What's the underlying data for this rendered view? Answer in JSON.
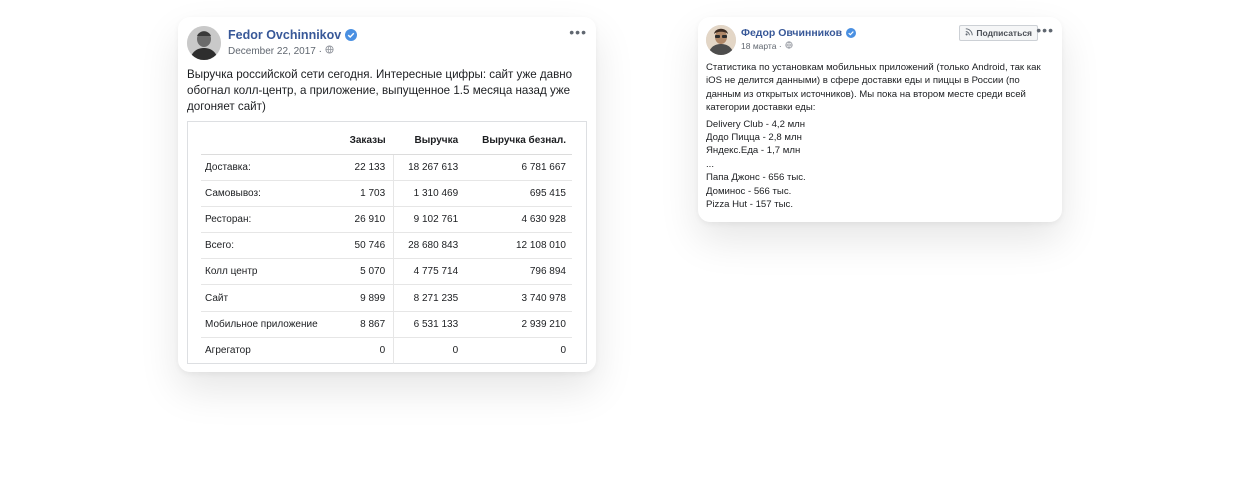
{
  "post_1": {
    "author": "Fedor Ovchinnikov",
    "date": "December 22, 2017 ·",
    "text": "Выручка российской сети сегодня. Интересные цифры: сайт уже давно обогнал колл-центр, а приложение, выпущенное 1.5 месяца назад уже догоняет сайт)",
    "table": {
      "headers": [
        "",
        "Заказы",
        "Выручка",
        "Выручка безнал."
      ],
      "rows": [
        [
          "Доставка:",
          "22 133",
          "18 267 613",
          "6 781 667"
        ],
        [
          "Самовывоз:",
          "1 703",
          "1 310 469",
          "695 415"
        ],
        [
          "Ресторан:",
          "26 910",
          "9 102 761",
          "4 630 928"
        ],
        [
          "Всего:",
          "50 746",
          "28 680 843",
          "12 108 010"
        ],
        [
          "Колл центр",
          "5 070",
          "4 775 714",
          "796 894"
        ],
        [
          "Сайт",
          "9 899",
          "8 271 235",
          "3 740 978"
        ],
        [
          "Мобильное приложение",
          "8 867",
          "6 531 133",
          "2 939 210"
        ],
        [
          "Агрегатор",
          "0",
          "0",
          "0"
        ]
      ]
    }
  },
  "post_2": {
    "author": "Федор Овчинников",
    "date": "18 марта ·",
    "subscribe_label": "Подписаться",
    "intro": "Статистика по установкам мобильных приложений (только Android, так как iOS не делится данными) в сфере доставки еды и пиццы в России (по данным из открытых источников). Мы пока на втором месте среди всей категории доставки еды:",
    "ranking": [
      "Delivery Club - 4,2 млн",
      "Додо Пицца - 2,8 млн",
      "Яндекс.Еда - 1,7 млн",
      "...",
      "Папа Джонс - 656 тыс.",
      "Доминос - 566 тыс.",
      "Pizza Hut - 157 тыс."
    ]
  },
  "icons": {
    "verified": "verified-badge-icon",
    "globe": "globe-icon",
    "more": "more-options-icon",
    "rss": "rss-icon"
  },
  "colors": {
    "author_link": "#385898",
    "verified_badge": "#4a90e2",
    "meta_text": "#606770"
  }
}
